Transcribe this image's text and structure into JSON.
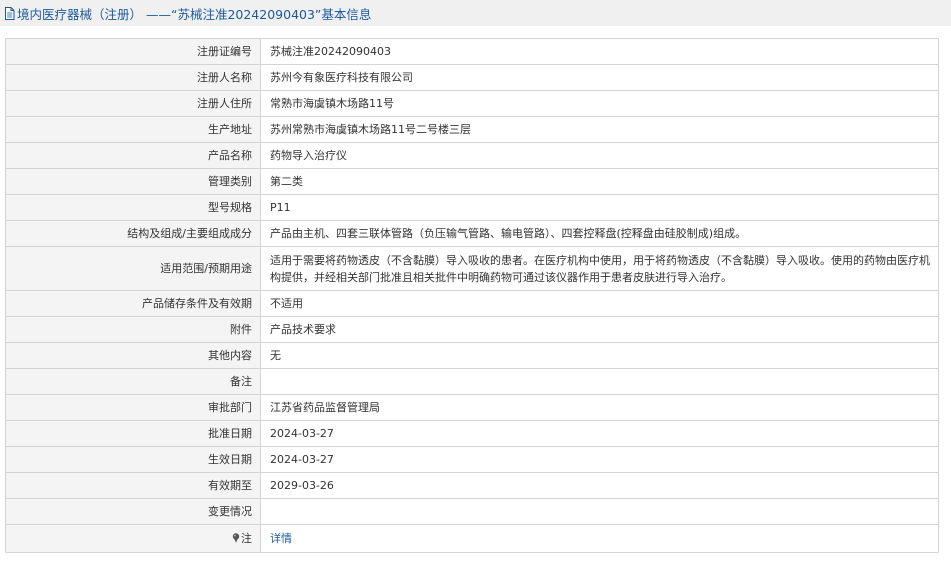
{
  "header": {
    "title": "境内医疗器械（注册） ——“苏械注准20242090403”基本信息"
  },
  "rows": [
    {
      "label": "注册证编号",
      "value": "苏械注准20242090403"
    },
    {
      "label": "注册人名称",
      "value": "苏州今有象医疗科技有限公司"
    },
    {
      "label": "注册人住所",
      "value": "常熟市海虞镇木场路11号"
    },
    {
      "label": "生产地址",
      "value": "苏州常熟市海虞镇木场路11号二号楼三层"
    },
    {
      "label": "产品名称",
      "value": "药物导入治疗仪"
    },
    {
      "label": "管理类别",
      "value": "第二类"
    },
    {
      "label": "型号规格",
      "value": "P11"
    },
    {
      "label": "结构及组成/主要组成成分",
      "value": "产品由主机、四套三联体管路（负压输气管路、输电管路）、四套控释盘(控释盘由硅胶制成)组成。"
    },
    {
      "label": "适用范围/预期用途",
      "value": "适用于需要将药物透皮（不含黏膜）导入吸收的患者。在医疗机构中使用，用于将药物透皮（不含黏膜）导入吸收。使用的药物由医疗机构提供，并经相关部门批准且相关批件中明确药物可通过该仪器作用于患者皮肤进行导入治疗。"
    },
    {
      "label": "产品储存条件及有效期",
      "value": "不适用"
    },
    {
      "label": "附件",
      "value": "产品技术要求"
    },
    {
      "label": "其他内容",
      "value": "无"
    },
    {
      "label": "备注",
      "value": ""
    },
    {
      "label": "审批部门",
      "value": "江苏省药品监督管理局"
    },
    {
      "label": "批准日期",
      "value": "2024-03-27"
    },
    {
      "label": "生效日期",
      "value": "2024-03-27"
    },
    {
      "label": "有效期至",
      "value": "2029-03-26"
    },
    {
      "label": "变更情况",
      "value": ""
    }
  ],
  "note_row": {
    "label": "注",
    "link_text": "详情"
  },
  "icons": {
    "title": "document-icon",
    "note": "pin-icon"
  },
  "colors": {
    "title_text": "#1c5a9c",
    "link": "#1c5a9c",
    "label_bg": "#f4f4f4",
    "border": "#d4d4d4",
    "header_bg": "#f0f0f0"
  }
}
